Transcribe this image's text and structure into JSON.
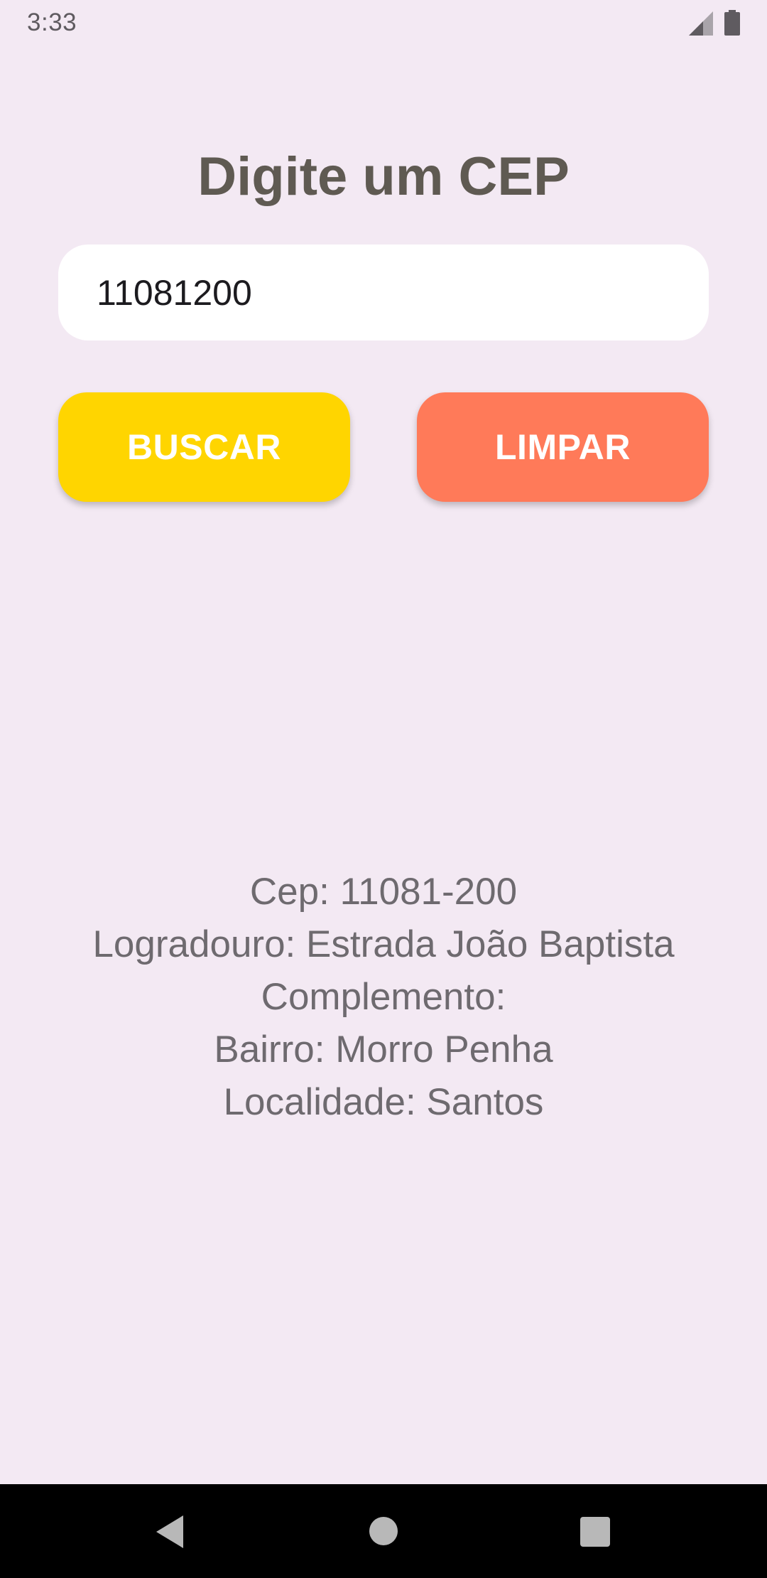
{
  "status_bar": {
    "time": "3:33",
    "icons": [
      "signal-icon",
      "battery-icon"
    ]
  },
  "title": "Digite um CEP",
  "cep_input": {
    "value": "11081200",
    "placeholder": ""
  },
  "buttons": {
    "search_label": "BUSCAR",
    "clear_label": "LIMPAR"
  },
  "result": {
    "cep": "Cep: 11081-200",
    "logradouro": "Logradouro: Estrada João Baptista",
    "complemento": "Complemento:",
    "bairro": "Bairro: Morro Penha",
    "localidade": "Localidade: Santos"
  },
  "nav_bar": {
    "icons": [
      "back-icon",
      "home-icon",
      "recents-icon"
    ]
  },
  "colors": {
    "background": "#f3e9f3",
    "search_button": "#ffd500",
    "clear_button": "#ff7a59",
    "title_text": "#5f5a52",
    "result_text": "#6e6a6f"
  }
}
